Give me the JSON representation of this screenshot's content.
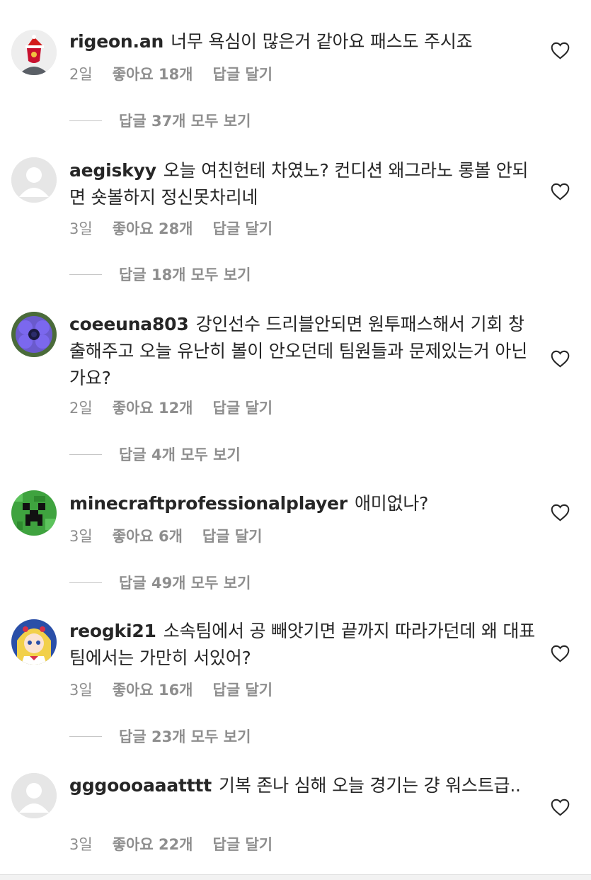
{
  "comments": [
    {
      "username": "rigeon.an",
      "text": "너무 욕심이 많은거 같아요 패스도 주시죠",
      "time": "2일",
      "likes": "좋아요 18개",
      "reply": "답글 달기",
      "view_replies": "답글 37개 모두 보기",
      "avatar_icon": "liverpool-crest-santa-hat-avatar"
    },
    {
      "username": "aegiskyy",
      "text": "오늘 여친헌테 차였노? 컨디션 왜그라노 롱볼 안되면 숏볼하지 정신못차리네",
      "time": "3일",
      "likes": "좋아요 28개",
      "reply": "답글 달기",
      "view_replies": "답글 18개 모두 보기",
      "avatar_icon": "default-person-avatar"
    },
    {
      "username": "coeeuna803",
      "text": "강인선수 드리블안되면 원투패스해서 기회 창출해주고 오늘 유난히 볼이 안오던데 팀원들과 문제있는거 아닌가요?",
      "time": "2일",
      "likes": "좋아요 12개",
      "reply": "답글 달기",
      "view_replies": "답글 4개 모두 보기",
      "avatar_icon": "purple-flower-avatar"
    },
    {
      "username": "minecraftprofessionalplayer",
      "text": "애미없나?",
      "time": "3일",
      "likes": "좋아요 6개",
      "reply": "답글 달기",
      "view_replies": "답글 49개 모두 보기",
      "avatar_icon": "creeper-avatar"
    },
    {
      "username": "reogki21",
      "text": "소속팀에서 공 빼앗기면 끝까지 따라가던데 왜 대표팀에서는 가만히 서있어?",
      "time": "3일",
      "likes": "좋아요 16개",
      "reply": "답글 달기",
      "view_replies": "답글 23개 모두 보기",
      "avatar_icon": "anime-character-avatar"
    },
    {
      "username": "gggoooaaatttt",
      "text": "기복 존나 심해 오늘 경기는 걍 워스트급..",
      "time": "3일",
      "likes": "좋아요 22개",
      "reply": "답글 달기",
      "avatar_icon": "default-person-avatar"
    }
  ],
  "colors": {
    "text": "#262626",
    "secondary": "#8e8e8e",
    "divider": "#c7c7c7"
  }
}
